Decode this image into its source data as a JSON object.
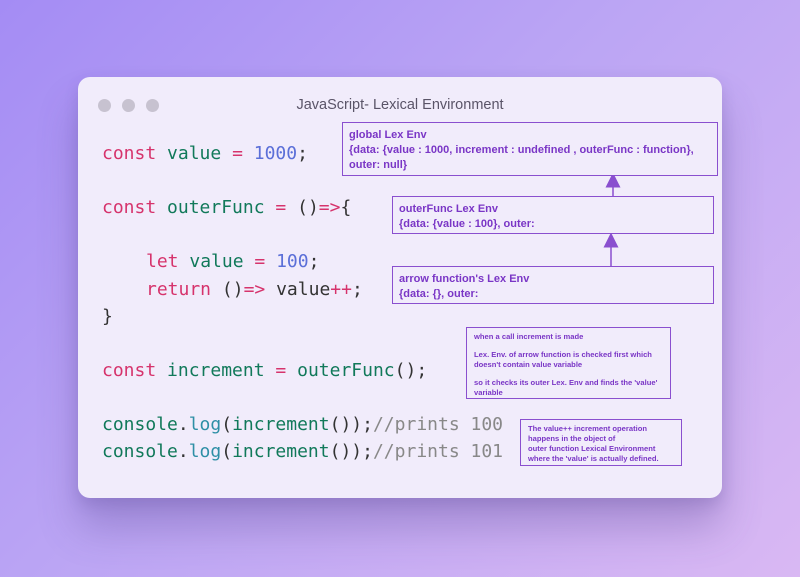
{
  "window": {
    "title": "JavaScript- Lexical Environment"
  },
  "code": {
    "line1": {
      "kw": "const",
      "id": "value",
      "op": "=",
      "num": "1000",
      "end": ";"
    },
    "line2": {
      "kw": "const",
      "id": "outerFunc",
      "op": "=",
      "paren": "()",
      "arrow": "=>",
      "brace": "{"
    },
    "line3": {
      "kw": "let",
      "id": "value",
      "op": "=",
      "num": "100",
      "end": ";"
    },
    "line4": {
      "kw": "return",
      "paren": "()",
      "arrow": "=>",
      "id": "value",
      "op": "++",
      "end": ";"
    },
    "line5": {
      "brace": "}"
    },
    "line6": {
      "kw": "const",
      "id": "increment",
      "op": "=",
      "call": "outerFunc",
      "rest": "();"
    },
    "line7": {
      "obj": "console",
      "dot": ".",
      "fn": "log",
      "open": "(",
      "id": "increment",
      "close": "());",
      "comment": "//prints 100"
    },
    "line8": {
      "obj": "console",
      "dot": ".",
      "fn": "log",
      "open": "(",
      "id": "increment",
      "close": "());",
      "comment": "//prints 101"
    }
  },
  "boxes": {
    "global": {
      "title": "global Lex Env",
      "line1": "{data: {value : 1000, increment : undefined , outerFunc : function},",
      "line2": "outer: null}"
    },
    "outer": {
      "title": "outerFunc Lex Env",
      "line1": "{data: {value : 100}, outer:"
    },
    "arrow": {
      "title": "arrow function's Lex Env",
      "line1": "{data: {}, outer:"
    },
    "note1": {
      "l1": "when a call increment is made",
      "l2": "Lex. Env. of arrow function is checked first which",
      "l3": "doesn't contain value variable",
      "l4": "so it checks its outer Lex. Env and finds the 'value'",
      "l5": "variable"
    },
    "note2": {
      "l1": "The value++ increment operation",
      "l2": "happens in the object of",
      "l3": "outer function Lexical Environment",
      "l4": "where the 'value' is actually defined."
    }
  },
  "colors": {
    "keyword": "#d6336c",
    "identifier": "#11795a",
    "number": "#5b6fd8",
    "function": "#2e8fa6",
    "comment": "#888888",
    "annotation": "#8a4fcf"
  }
}
